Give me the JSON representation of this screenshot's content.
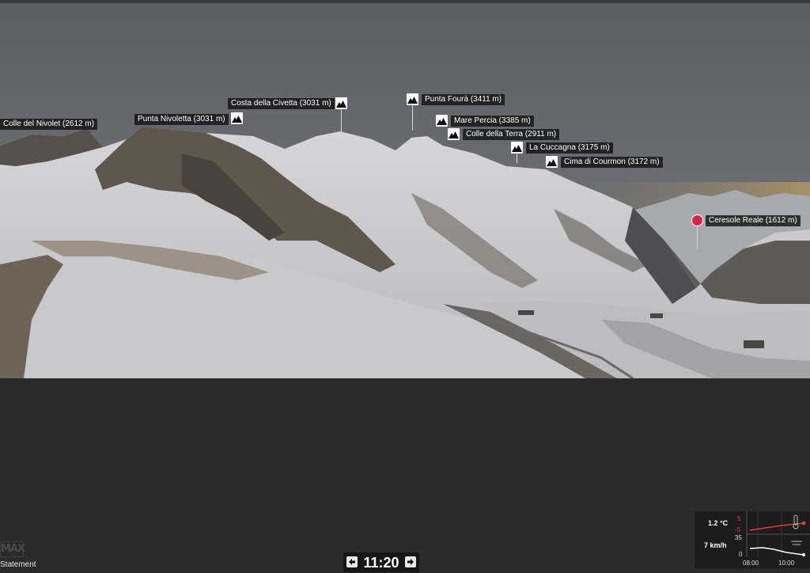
{
  "peaks": [
    {
      "name": "Colle del Nivolet (2612 m)",
      "icon": "mountain-icon"
    },
    {
      "name": "Punta Nivoletta (3031 m)",
      "icon": "mountain-icon"
    },
    {
      "name": "Costa della Civetta (3031 m)",
      "icon": "mountain-icon"
    },
    {
      "name": "Punta Fourà (3411 m)",
      "icon": "mountain-icon"
    },
    {
      "name": "Mare Percia (3385 m)",
      "icon": "mountain-icon"
    },
    {
      "name": "Colle della Terra (2911 m)",
      "icon": "mountain-icon"
    },
    {
      "name": "La Cuccagna (3175 m)",
      "icon": "mountain-icon"
    },
    {
      "name": "Cima di Courmon (3172 m)",
      "icon": "mountain-icon"
    }
  ],
  "place": {
    "name": "Ceresole Reale (1612 m)",
    "icon": "location-pin-icon",
    "color": "#d6234a"
  },
  "footer": {
    "logo": "MAX",
    "statement": "Statement"
  },
  "timebar": {
    "time": "11:20",
    "prev_icon": "arrow-left-icon",
    "next_icon": "arrow-right-icon"
  },
  "weather": {
    "temperature": "1.2 °C",
    "wind": "7 km/h",
    "temp_axis_top": "5",
    "temp_axis_bottom": "-5",
    "wind_axis_top": "35",
    "wind_axis_bottom": "0",
    "time_start": "08:00",
    "time_end": "10:00",
    "temp_line_color": "#e03a3a",
    "wind_line_color": "#ffffff"
  }
}
